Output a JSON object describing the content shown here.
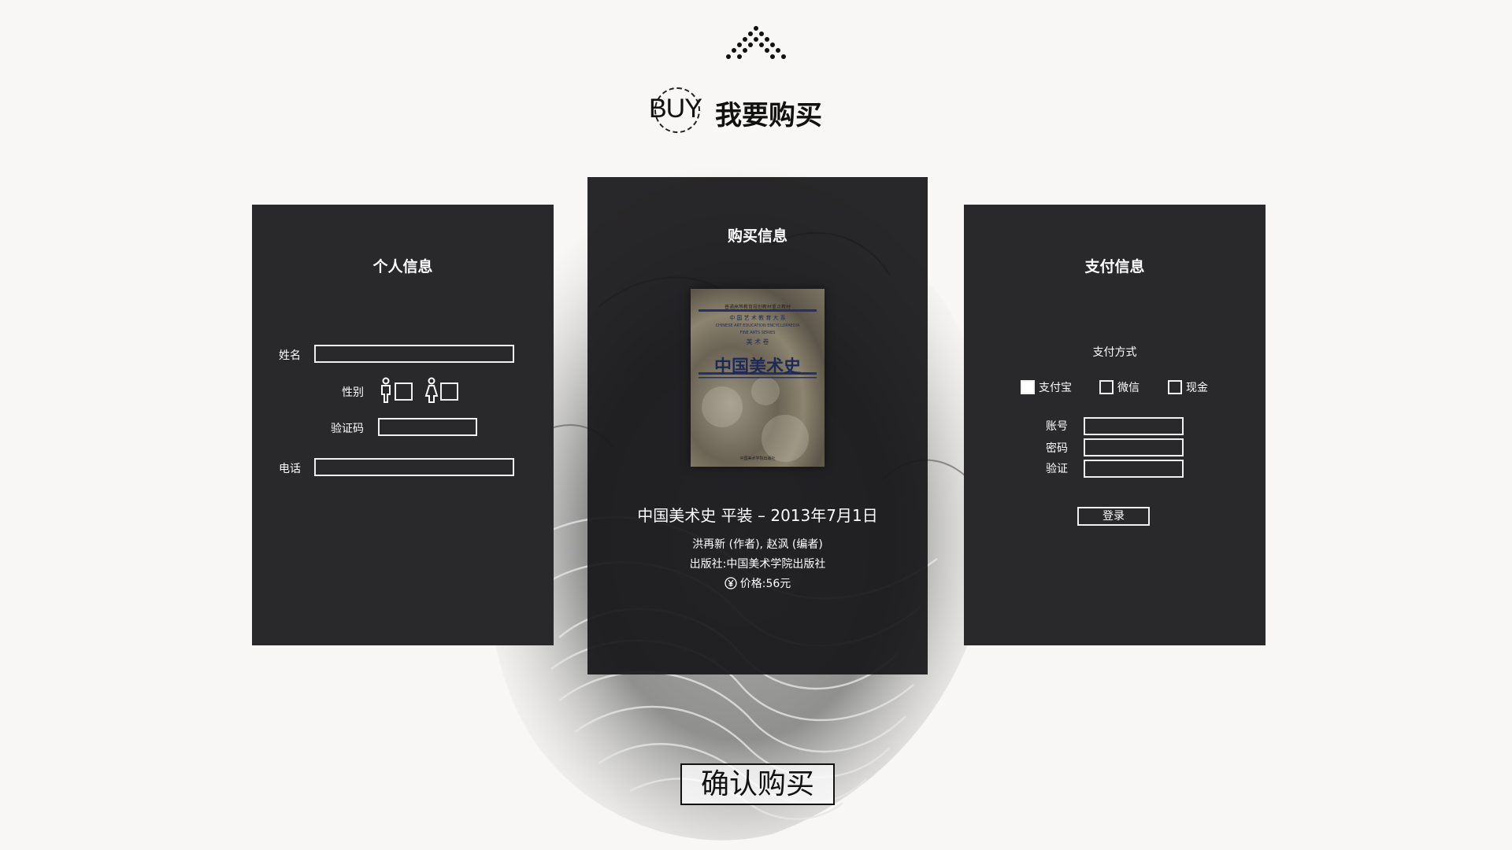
{
  "header": {
    "logo_icon": "dotted-triangle-icon",
    "badge_text": "BUY",
    "title": "我要购买"
  },
  "personal": {
    "title": "个人信息",
    "name_label": "姓名",
    "gender_label": "性别",
    "male_icon": "male-person-icon",
    "female_icon": "female-person-icon",
    "captcha_label": "验证码",
    "phone_label": "电话"
  },
  "purchase": {
    "title": "购买信息",
    "cover": {
      "top_line": "普通高等教育规划教材重点教材",
      "series_cn": "中 国 艺 术 教 育 大 系",
      "series_en": "CHINESE ART EDUCATION ENCYCLOPAEDIA",
      "subseries": "FINE ARTS SERIES",
      "kind": "美 术 卷",
      "book_title": "中国美术史",
      "publisher": "中国美术学院出版社"
    },
    "book_line": "中国美术史 平装 – 2013年7月1日",
    "authors": "洪再新 (作者), 赵沨 (编者)",
    "publisher_line": "出版社:中国美术学院出版社",
    "price_icon": "yen-circle-icon",
    "price": "价格:56元"
  },
  "payment": {
    "title": "支付信息",
    "method_label": "支付方式",
    "options": [
      {
        "label": "支付宝",
        "checked": true
      },
      {
        "label": "微信",
        "checked": false
      },
      {
        "label": "现金",
        "checked": false
      }
    ],
    "account_label": "账号",
    "password_label": "密码",
    "verify_label": "验证",
    "login_label": "登录"
  },
  "confirm_label": "确认购买",
  "colors": {
    "page_bg": "#f8f7f5",
    "panel_bg": "#29282a",
    "book_title": "#1e2a55",
    "text_dark": "#111111",
    "text_light": "#ffffff"
  }
}
